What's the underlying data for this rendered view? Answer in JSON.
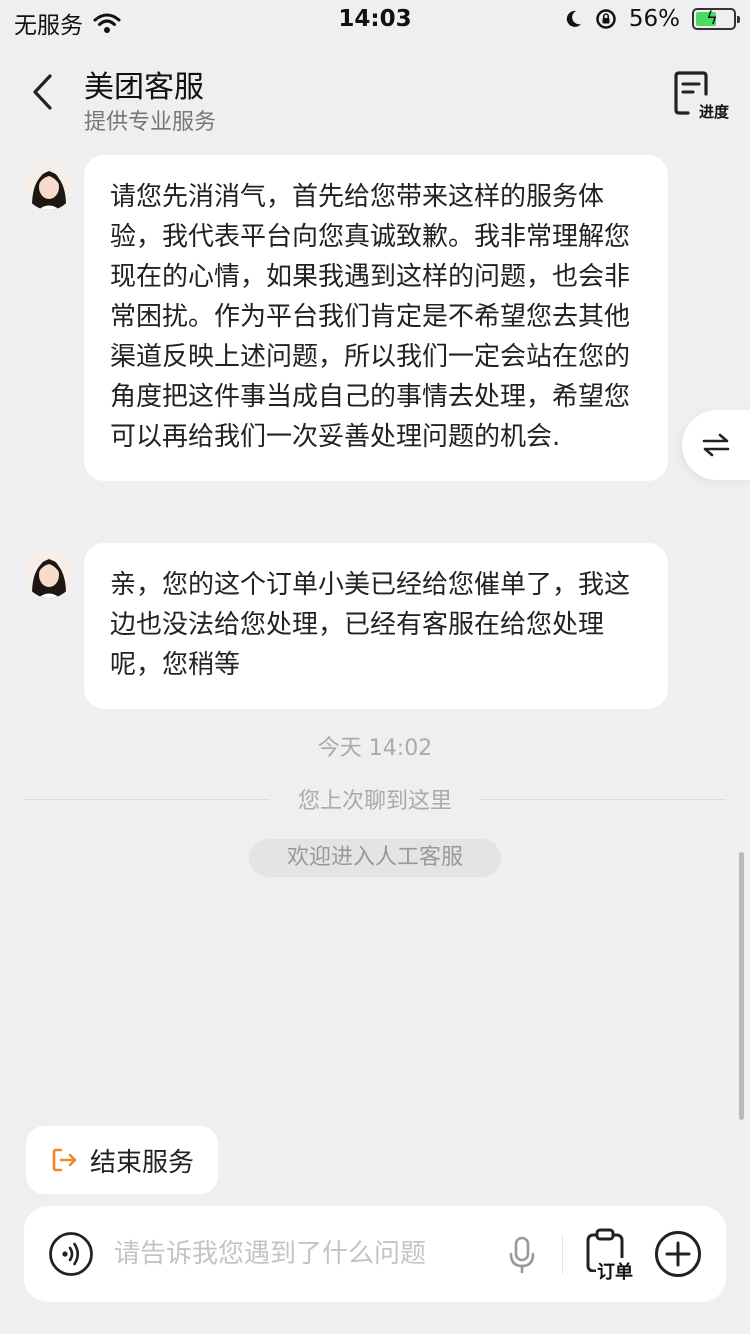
{
  "status_bar": {
    "carrier": "无服务",
    "time": "14:03",
    "battery_text": "56%",
    "battery_level": 0.56
  },
  "header": {
    "title": "美团客服",
    "subtitle": "提供专业服务",
    "progress_label": "进度"
  },
  "messages": [
    {
      "text": "请您先消消气，首先给您带来这样的服务体验，我代表平台向您真诚致歉。我非常理解您现在的心情，如果我遇到这样的问题，也会非常困扰。作为平台我们肯定是不希望您去其他渠道反映上述问题，所以我们一定会站在您的角度把这件事当成自己的事情去处理，希望您可以再给我们一次妥善处理问题的机会."
    },
    {
      "text": "亲，您的这个订单小美已经给您催单了，我这边也没法给您处理，已经有客服在给您处理呢，您稍等"
    }
  ],
  "timeline": {
    "timestamp": "今天 14:02",
    "last_read": "您上次聊到这里",
    "welcome": "欢迎进入人工客服"
  },
  "end_service_label": "结束服务",
  "input_bar": {
    "placeholder": "请告诉我您遇到了什么问题",
    "value": "",
    "order_label": "订单"
  },
  "colors": {
    "accent": "#f08a24",
    "background": "#efeff1",
    "bubble": "#ffffff"
  }
}
